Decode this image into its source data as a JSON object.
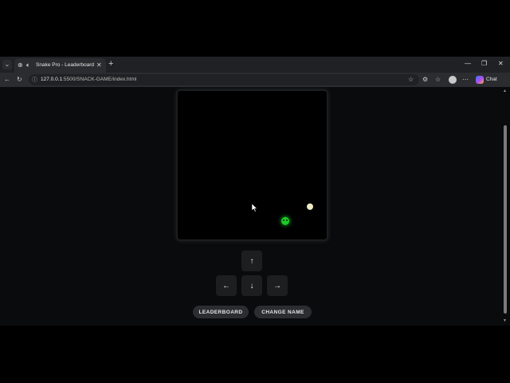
{
  "browser": {
    "tab": {
      "title": "Snake Pro - Leaderboard"
    },
    "url": {
      "host": "127.0.0.1",
      "path": ":5500/SNACK-GAME/index.html"
    },
    "chat_label": "Chat"
  },
  "controls": {
    "up": "↑",
    "left": "←",
    "down": "↓",
    "right": "→"
  },
  "buttons": {
    "leaderboard": "LEADERBOARD",
    "change_name": "CHANGE NAME"
  },
  "colors": {
    "snake": "#1ec92a",
    "food": "#ecebc4",
    "board": "#000000"
  }
}
